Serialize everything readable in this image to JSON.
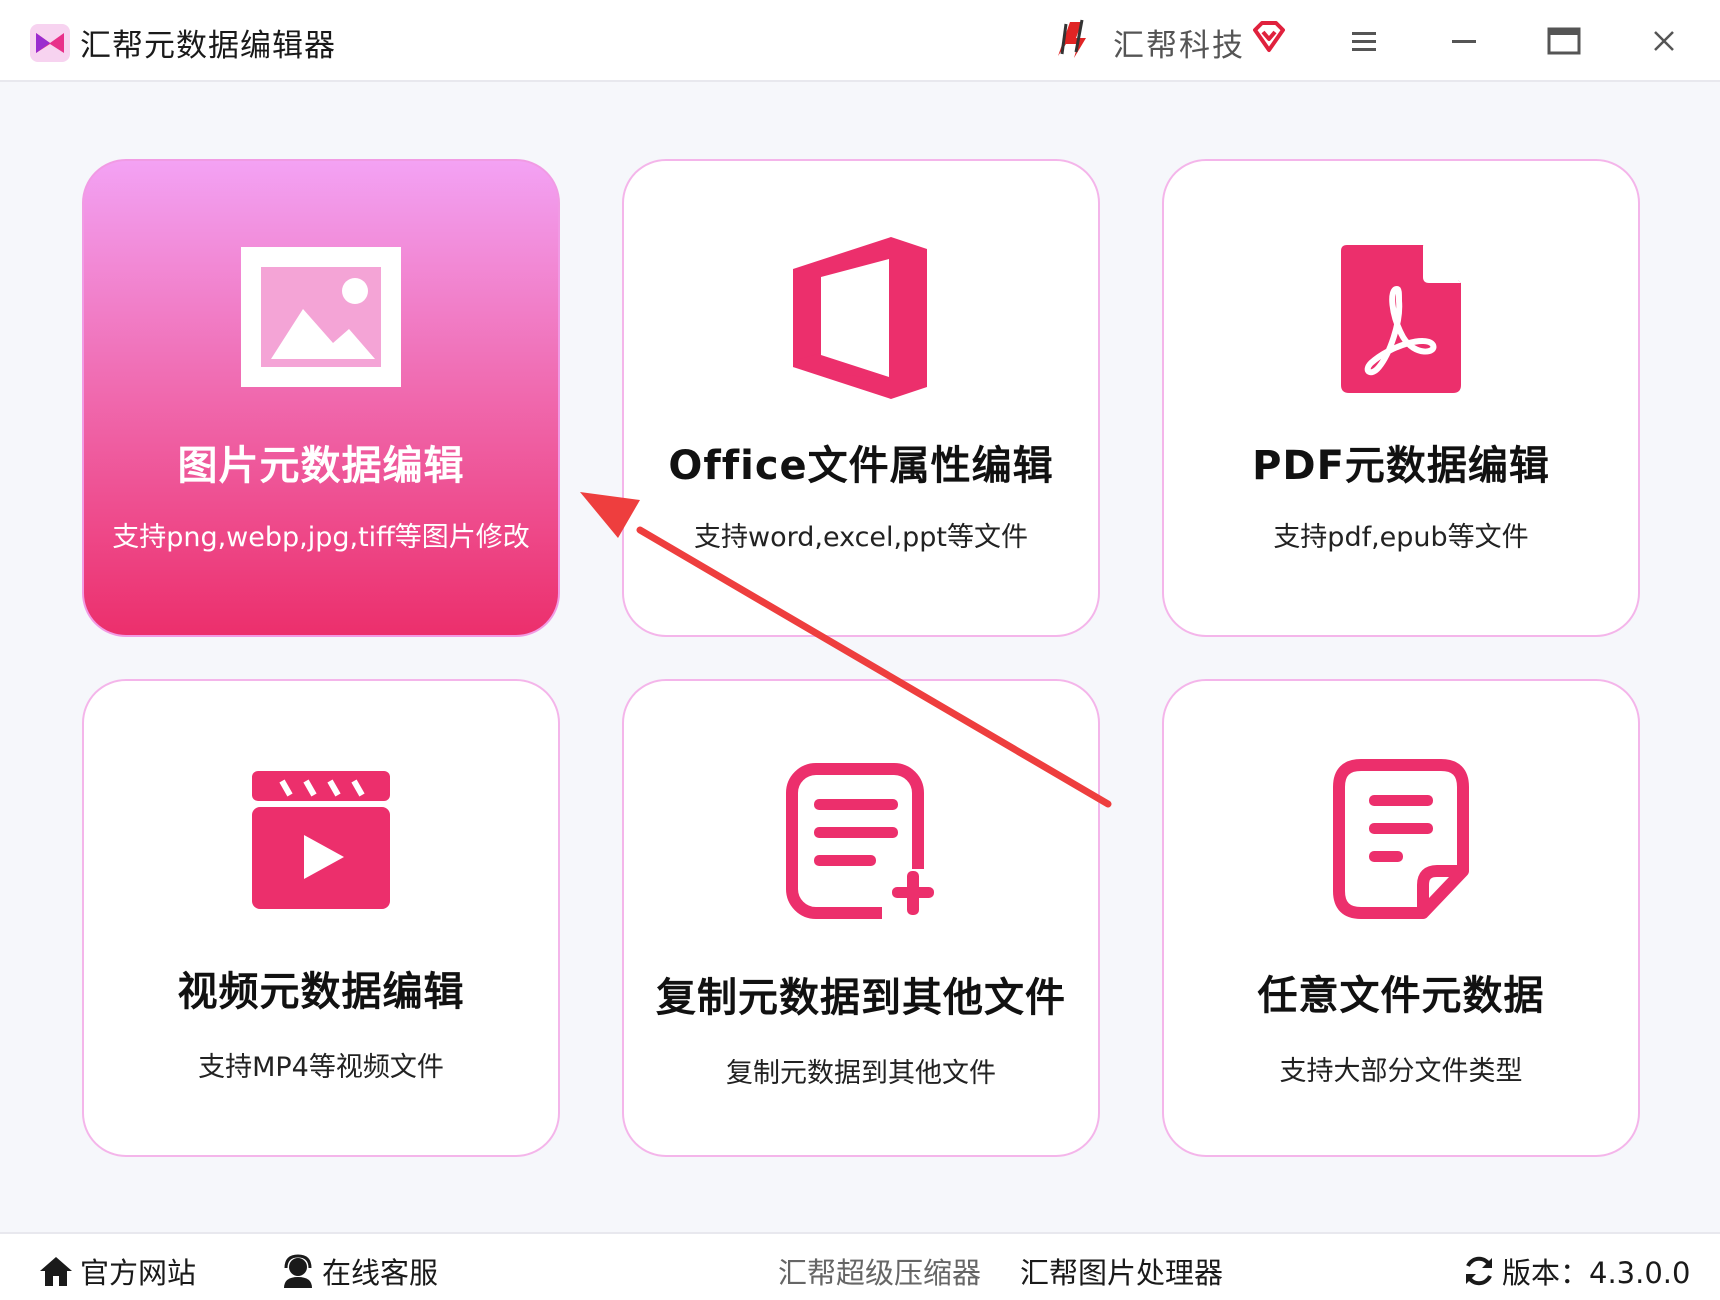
{
  "app": {
    "title": "汇帮元数据编辑器",
    "brand": "汇帮科技"
  },
  "window_controls": {
    "menu_icon": "hamburger-icon",
    "minimize_icon": "minimize-icon",
    "maximize_icon": "maximize-icon",
    "close_icon": "close-icon"
  },
  "cards": [
    {
      "title": "图片元数据编辑",
      "desc": "支持png,webp,jpg,tiff等图片修改",
      "icon": "image-icon",
      "active": true
    },
    {
      "title": "Office文件属性编辑",
      "desc": "支持word,excel,ppt等文件",
      "icon": "office-icon",
      "active": false
    },
    {
      "title": "PDF元数据编辑",
      "desc": "支持pdf,epub等文件",
      "icon": "pdf-icon",
      "active": false
    },
    {
      "title": "视频元数据编辑",
      "desc": "支持MP4等视频文件",
      "icon": "video-icon",
      "active": false
    },
    {
      "title": "复制元数据到其他文件",
      "desc": "复制元数据到其他文件",
      "icon": "copy-document-icon",
      "active": false
    },
    {
      "title": "任意文件元数据",
      "desc": "支持大部分文件类型",
      "icon": "document-icon",
      "active": false
    }
  ],
  "footer": {
    "website": "官方网站",
    "service": "在线客服",
    "compressor": "汇帮超级压缩器",
    "image_tool": "汇帮图片处理器",
    "version": "版本：4.3.0.0"
  },
  "colors": {
    "accent": "#ec2f6c",
    "card_border": "#f4b5ea",
    "gradient_top": "#f3a2f4",
    "annotation_arrow": "#ee3e3e"
  }
}
